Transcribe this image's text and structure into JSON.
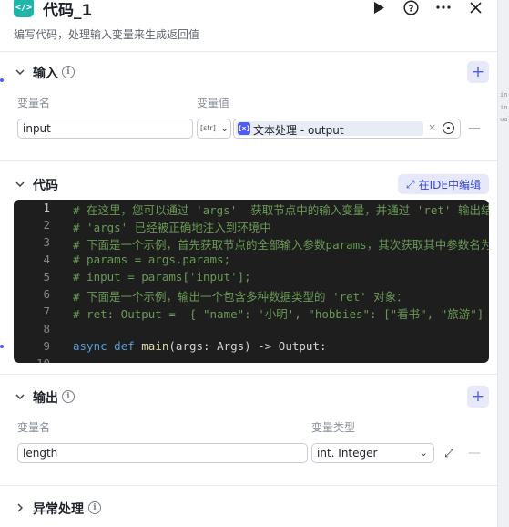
{
  "header": {
    "app_icon": "</>",
    "title": "代码_1",
    "description": "编写代码，处理输入变量来生成返回值",
    "run_icon": "play-icon",
    "help_icon": "help-icon",
    "more_icon": "more-icon",
    "close_icon": "close-icon"
  },
  "input_section": {
    "title": "输入",
    "col_name": "变量名",
    "col_value": "变量值",
    "rows": [
      {
        "name": "input",
        "type_badge": "[str]",
        "ref_icon": "{x}",
        "ref_value": "文本处理 - output"
      }
    ]
  },
  "code_section": {
    "title": "代码",
    "ide_button": "在IDE中编辑",
    "lines": [
      {
        "n": "1",
        "text": "# 在这里，您可以通过 'args'  获取节点中的输入变量，并通过 'ret' 输出结果"
      },
      {
        "n": "2",
        "text": "# 'args' 已经被正确地注入到环境中"
      },
      {
        "n": "3",
        "text": "# 下面是一个示例，首先获取节点的全部输入参数params，其次获取其中参数名为'input'的值："
      },
      {
        "n": "4",
        "text": "# params = args.params;"
      },
      {
        "n": "5",
        "text": "# input = params['input'];"
      },
      {
        "n": "6",
        "text": "# 下面是一个示例，输出一个包含多种数据类型的 'ret' 对象："
      },
      {
        "n": "7",
        "text": "# ret: Output =  { \"name\": '小明', \"hobbies\": [\"看书\", \"旅游\"] };"
      },
      {
        "n": "8",
        "text": ""
      },
      {
        "n": "9",
        "kw1": "async",
        "kw2": "def",
        "fn": "main",
        "rest": "(args: Args) -> Output:"
      },
      {
        "n": "10",
        "text": ""
      }
    ]
  },
  "output_section": {
    "title": "输出",
    "col_name": "变量名",
    "col_type": "变量类型",
    "rows": [
      {
        "name": "length",
        "type": "int. Integer"
      }
    ]
  },
  "exception_section": {
    "title": "异常处理"
  },
  "right_strip": [
    "in",
    "in",
    "ua]"
  ],
  "colors": {
    "accent": "#4e5df0",
    "app_icon_bg": "#1fb5a8",
    "editor_bg": "#1e1e1e",
    "comment": "#6a9955",
    "keyword": "#569cd6"
  }
}
